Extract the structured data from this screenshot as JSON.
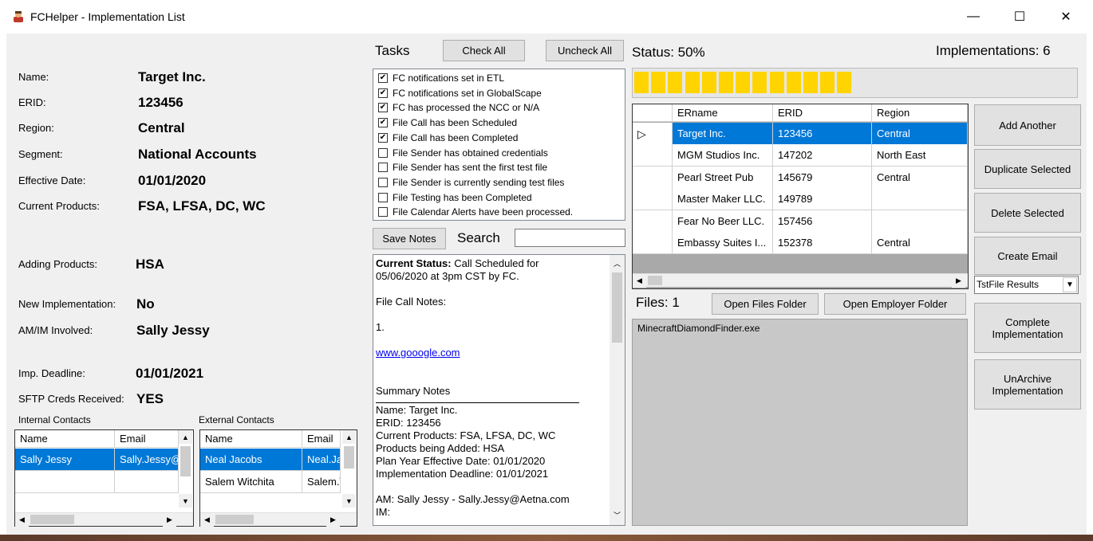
{
  "window": {
    "title": "FCHelper - Implementation List",
    "minimize": "—",
    "maximize": "☐",
    "close": "✕"
  },
  "fields": [
    {
      "label": "Name:",
      "value": "Target Inc."
    },
    {
      "label": "ERID:",
      "value": "123456"
    },
    {
      "label": "Region:",
      "value": "Central"
    },
    {
      "label": "Segment:",
      "value": "National Accounts"
    },
    {
      "label": "Effective Date:",
      "value": "01/01/2020"
    },
    {
      "label": "Current Products:",
      "value": "FSA, LFSA, DC, WC"
    },
    {
      "label": "Adding Products:",
      "value": "HSA"
    },
    {
      "label": "New Implementation:",
      "value": "No"
    },
    {
      "label": "AM/IM Involved:",
      "value": "Sally Jessy"
    },
    {
      "label": "Imp. Deadline:",
      "value": "01/01/2021"
    },
    {
      "label": "SFTP Creds Received:",
      "value": "YES"
    }
  ],
  "internal_contacts": {
    "title": "Internal Contacts",
    "columns": [
      "Name",
      "Email"
    ],
    "rows": [
      [
        "Sally Jessy",
        "Sally.Jessy@"
      ]
    ]
  },
  "external_contacts": {
    "title": "External Contacts",
    "columns": [
      "Name",
      "Email"
    ],
    "rows": [
      [
        "Neal Jacobs",
        "Neal.Ja"
      ],
      [
        "Salem Witchita",
        "Salem.\\"
      ]
    ]
  },
  "tasks": {
    "title": "Tasks",
    "check_all": "Check All",
    "uncheck_all": "Uncheck All",
    "items": [
      {
        "label": "FC notifications set in ETL",
        "checked": true
      },
      {
        "label": "FC notifications set in GlobalScape",
        "checked": true
      },
      {
        "label": "FC has processed the NCC or N/A",
        "checked": true
      },
      {
        "label": "File Call has been Scheduled",
        "checked": true
      },
      {
        "label": "File Call has been Completed",
        "checked": true
      },
      {
        "label": "File Sender has obtained credentials",
        "checked": false
      },
      {
        "label": "File Sender has sent the first test file",
        "checked": false
      },
      {
        "label": "File Sender is currently sending test files",
        "checked": false
      },
      {
        "label": "File Testing has been Completed",
        "checked": false
      },
      {
        "label": "File Calendar Alerts have been processed.",
        "checked": false
      }
    ]
  },
  "notes": {
    "save_label": "Save Notes",
    "search_label": "Search",
    "search_value": "",
    "status_label": "Current Status:",
    "status_text": " Call Scheduled for",
    "status_line2": "05/06/2020 at 3pm CST by FC.",
    "file_call_notes": "File Call Notes:",
    "item1": "1.",
    "link": "www.gooogle.com",
    "summary_label": "Summary Notes",
    "summary_lines": [
      "Name: Target Inc.",
      "ERID: 123456",
      "Current Products: FSA, LFSA, DC, WC",
      "Products being Added: HSA",
      "Plan Year Effective Date: 01/01/2020",
      "Implementation Deadline: 01/01/2021",
      "",
      "AM:  Sally Jessy - Sally.Jessy@Aetna.com",
      "IM:"
    ]
  },
  "status": {
    "label": "Status: 50%",
    "progress": 0.5,
    "implementations_label": "Implementations: 6"
  },
  "impl_grid": {
    "columns": [
      "ERname",
      "ERID",
      "Region"
    ],
    "rows": [
      [
        "Target Inc.",
        "123456",
        "Central"
      ],
      [
        "MGM Studios Inc.",
        "147202",
        "North East"
      ],
      [
        "Pearl Street Pub",
        "145679",
        "Central"
      ],
      [
        "Master Maker LLC.",
        "149789",
        ""
      ],
      [
        "Fear No Beer LLC.",
        "157456",
        ""
      ],
      [
        "Embassy Suites I...",
        "152378",
        "Central"
      ]
    ],
    "selected_row": 0
  },
  "files": {
    "label": "Files: 1",
    "open_files_folder": "Open Files Folder",
    "open_employer_folder": "Open Employer Folder",
    "items": [
      "MinecraftDiamondFinder.exe"
    ]
  },
  "actions": {
    "add_another": "Add Another",
    "duplicate_selected": "Duplicate Selected",
    "delete_selected": "Delete Selected",
    "create_email": "Create Email",
    "email_template": "TstFile Results",
    "complete_line1": "Complete",
    "complete_line2": "Implementation",
    "unarchive_line1": "UnArchive",
    "unarchive_line2": "Implementation"
  },
  "colors": {
    "selection": "#0078d7",
    "progress": "#ffd400"
  }
}
